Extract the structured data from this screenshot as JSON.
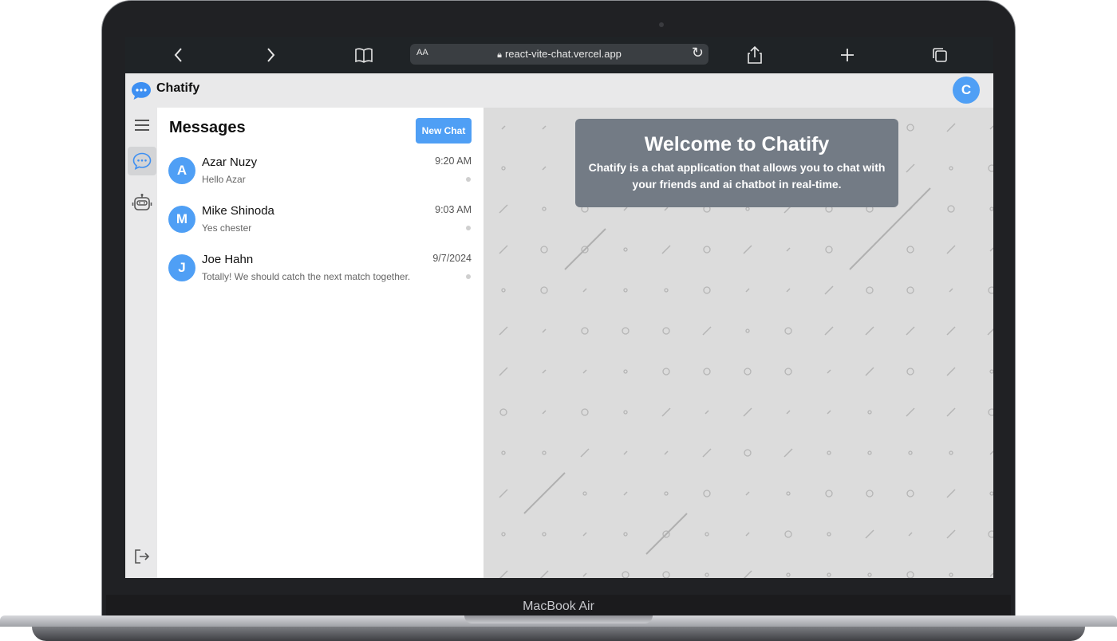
{
  "device": {
    "label": "MacBook Air"
  },
  "browser": {
    "url": "react-vite-chat.vercel.app",
    "text_size_label": "AA",
    "icons": [
      "back-icon",
      "forward-icon",
      "bookmarks-icon",
      "lock-icon",
      "reload-icon",
      "share-icon",
      "new-tab-icon",
      "tabs-icon"
    ]
  },
  "app": {
    "brand": "Chatify",
    "user_initial": "C",
    "accent_color": "#4f9ff5"
  },
  "rail": {
    "icons": [
      "menu-icon",
      "chat-icon",
      "robot-icon",
      "logout-icon"
    ],
    "active": "chat-icon"
  },
  "messages": {
    "title": "Messages",
    "new_chat_label": "New Chat",
    "conversations": [
      {
        "initial": "A",
        "name": "Azar Nuzy",
        "time": "9:20 AM",
        "preview": "Hello Azar"
      },
      {
        "initial": "M",
        "name": "Mike Shinoda",
        "time": "9:03 AM",
        "preview": "Yes chester"
      },
      {
        "initial": "J",
        "name": "Joe Hahn",
        "time": "9/7/2024",
        "preview": "Totally! We should catch the next match together."
      }
    ]
  },
  "welcome": {
    "title": "Welcome to Chatify",
    "text": "Chatify is a chat application that allows you to chat with your friends and ai chatbot in real-time."
  }
}
